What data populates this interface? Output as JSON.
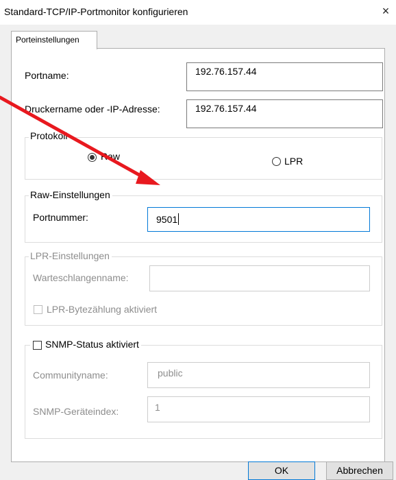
{
  "window": {
    "title": "Standard-TCP/IP-Portmonitor konfigurieren",
    "close_glyph": "×"
  },
  "tabs": [
    {
      "label": "Porteinstellungen",
      "selected": true
    }
  ],
  "fields": {
    "portname_label": "Portname:",
    "portname_value": "192.76.157.44",
    "printer_label": "Druckername oder -IP-Adresse:",
    "printer_value": "192.76.157.44"
  },
  "protocol": {
    "legend": "Protokoll",
    "options": [
      {
        "label": "Raw",
        "selected": true
      },
      {
        "label": "LPR",
        "selected": false
      }
    ]
  },
  "raw_settings": {
    "legend": "Raw-Einstellungen",
    "port_label": "Portnummer:",
    "port_value": "9501"
  },
  "lpr_settings": {
    "legend": "LPR-Einstellungen",
    "queue_label": "Warteschlangenname:",
    "queue_value": "",
    "bytecount_label": "LPR-Bytezählung aktiviert",
    "bytecount_checked": false
  },
  "snmp": {
    "legend": "SNMP-Status aktiviert",
    "enabled": false,
    "community_label": "Communityname:",
    "community_value": "public",
    "index_label": "SNMP-Geräteindex:",
    "index_value": "1"
  },
  "buttons": {
    "ok": "OK",
    "cancel": "Abbrechen"
  },
  "annotation": {
    "arrow_color": "#e8191f"
  }
}
